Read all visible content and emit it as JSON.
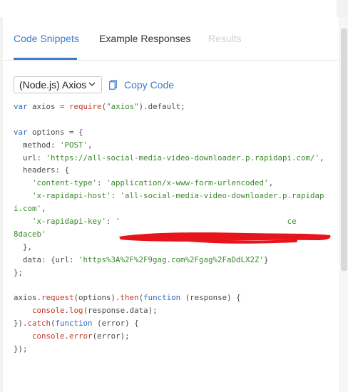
{
  "tabs": [
    {
      "label": "Code Snippets",
      "active": true
    },
    {
      "label": "Example Responses",
      "active": false
    },
    {
      "label": "Results",
      "active": false,
      "disabled": true
    }
  ],
  "toolbar": {
    "language": "(Node.js) Axios",
    "copy_label": "Copy Code",
    "copy_icon": "copy-icon",
    "chevron_icon": "chevron-down-icon"
  },
  "code_lines": [
    [
      [
        "kw",
        "var"
      ],
      [
        "pl",
        " axios = "
      ],
      [
        "fn",
        "require"
      ],
      [
        "pl",
        "("
      ],
      [
        "str",
        "\"axios\""
      ],
      [
        "pl",
        ").default;"
      ]
    ],
    [],
    [
      [
        "kw",
        "var"
      ],
      [
        "pl",
        " options = {"
      ]
    ],
    [
      [
        "pl",
        "  method: "
      ],
      [
        "str",
        "'POST'"
      ],
      [
        "pl",
        ","
      ]
    ],
    [
      [
        "pl",
        "  url: "
      ],
      [
        "str",
        "'https://all-social-media-video-downloader.p.rapidapi.com/'"
      ],
      [
        "pl",
        ","
      ]
    ],
    [
      [
        "pl",
        "  headers: {"
      ]
    ],
    [
      [
        "pl",
        "    "
      ],
      [
        "str",
        "'content-type'"
      ],
      [
        "pl",
        ": "
      ],
      [
        "str",
        "'application/x-www-form-urlencoded'"
      ],
      [
        "pl",
        ","
      ]
    ],
    [
      [
        "pl",
        "    "
      ],
      [
        "str",
        "'x-rapidapi-host'"
      ],
      [
        "pl",
        ": "
      ],
      [
        "str",
        "'all-social-media-video-downloader.p.rapidap"
      ]
    ],
    [
      [
        "str",
        "i.com'"
      ],
      [
        "pl",
        ","
      ]
    ],
    [
      [
        "pl",
        "    "
      ],
      [
        "str",
        "'x-rapidapi-key'"
      ],
      [
        "pl",
        ": "
      ],
      [
        "str",
        "'"
      ],
      [
        "pl",
        "                                    "
      ],
      [
        "str",
        "ce"
      ]
    ],
    [
      [
        "str",
        "8daceb'"
      ]
    ],
    [
      [
        "pl",
        "  },"
      ]
    ],
    [
      [
        "pl",
        "  data: {url: "
      ],
      [
        "str",
        "'https%3A%2F%2F9gag.com%2Fgag%2FaDdLX2Z'"
      ],
      [
        "pl",
        "}"
      ]
    ],
    [
      [
        "pl",
        "};"
      ]
    ],
    [],
    [
      [
        "pl",
        "axios."
      ],
      [
        "fn",
        "request"
      ],
      [
        "pl",
        "(options)."
      ],
      [
        "fn",
        "then"
      ],
      [
        "pl",
        "("
      ],
      [
        "kw",
        "function"
      ],
      [
        "pl",
        " (response) {"
      ]
    ],
    [
      [
        "pl",
        "    "
      ],
      [
        "fn",
        "console"
      ],
      [
        "pl",
        "."
      ],
      [
        "fn",
        "log"
      ],
      [
        "pl",
        "(response.data);"
      ]
    ],
    [
      [
        "pl",
        "})."
      ],
      [
        "fn",
        "catch"
      ],
      [
        "pl",
        "("
      ],
      [
        "kw",
        "function"
      ],
      [
        "pl",
        " (error) {"
      ]
    ],
    [
      [
        "pl",
        "    "
      ],
      [
        "fn",
        "console"
      ],
      [
        "pl",
        "."
      ],
      [
        "fn",
        "error"
      ],
      [
        "pl",
        "(error);"
      ]
    ],
    [
      [
        "pl",
        "});"
      ]
    ]
  ],
  "colors": {
    "accent": "#3d7cc9",
    "keyword": "#2e6bbf",
    "string": "#3a8a2a",
    "function": "#c0392b",
    "redaction": "#e8141b"
  }
}
